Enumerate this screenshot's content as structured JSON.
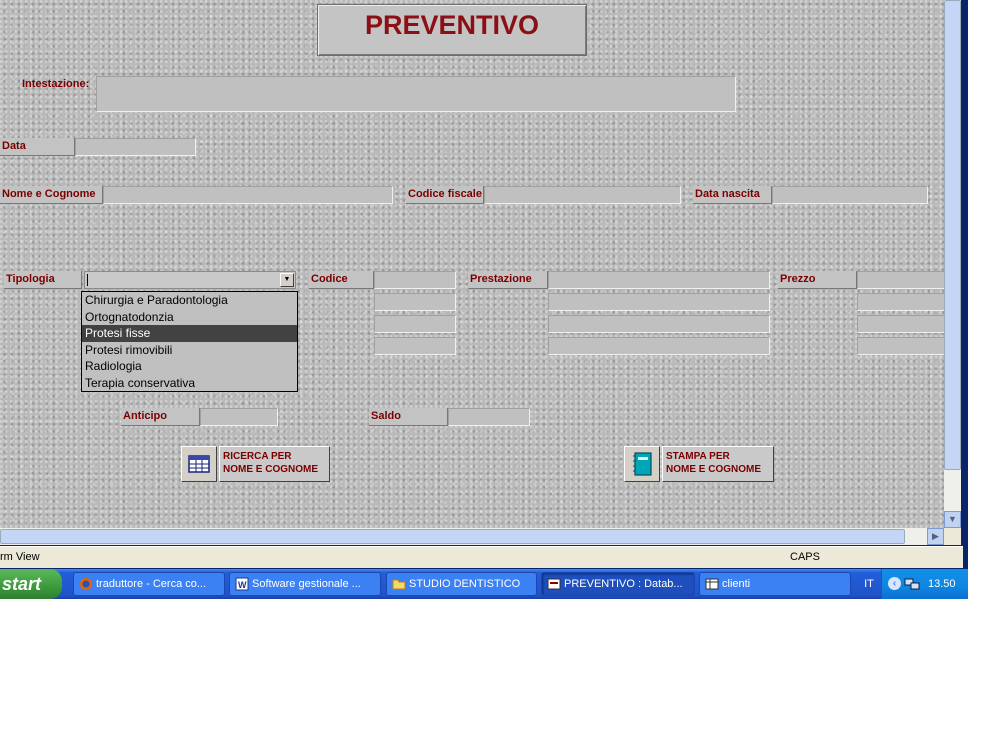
{
  "form": {
    "title": "PREVENTIVO",
    "labels": {
      "intestazione": "Intestazione:",
      "data": "Data",
      "nome_cognome": "Nome e Cognome",
      "codice_fiscale": "Codice fiscale",
      "data_nascita": "Data nascita",
      "tipologia": "Tipologia",
      "codice": "Codice",
      "prestazione": "Prestazione",
      "prezzo": "Prezzo",
      "anticipo": "Anticipo",
      "saldo": "Saldo"
    },
    "tipologia_options": [
      "Chirurgia e Paradontologia",
      "Ortognatodonzia",
      "Protesi fisse",
      "Protesi rimovibili",
      "Radiologia",
      "Terapia conservativa"
    ],
    "tipologia_selected": "Protesi fisse",
    "buttons": {
      "ricerca": "RICERCA PER\nNOME E COGNOME",
      "stampa": "STAMPA PER\nNOME E COGNOME"
    }
  },
  "statusbar": {
    "left": "rm View",
    "caps": "CAPS"
  },
  "taskbar": {
    "start": "start",
    "items": [
      {
        "label": "traduttore - Cerca co...",
        "icon": "firefox-icon",
        "active": false
      },
      {
        "label": "Software gestionale ...",
        "icon": "word-doc-icon",
        "active": false
      },
      {
        "label": "STUDIO DENTISTICO",
        "icon": "folder-icon",
        "active": false
      },
      {
        "label": "PREVENTIVO : Datab...",
        "icon": "access-form-icon",
        "active": true
      },
      {
        "label": "clienti",
        "icon": "access-table-icon",
        "active": false
      }
    ],
    "language": "IT",
    "clock": "13.50"
  },
  "colors": {
    "label_text": "#7a0000",
    "title_text": "#8b0f14",
    "taskbar": "#245edb",
    "selection": "#424242"
  }
}
